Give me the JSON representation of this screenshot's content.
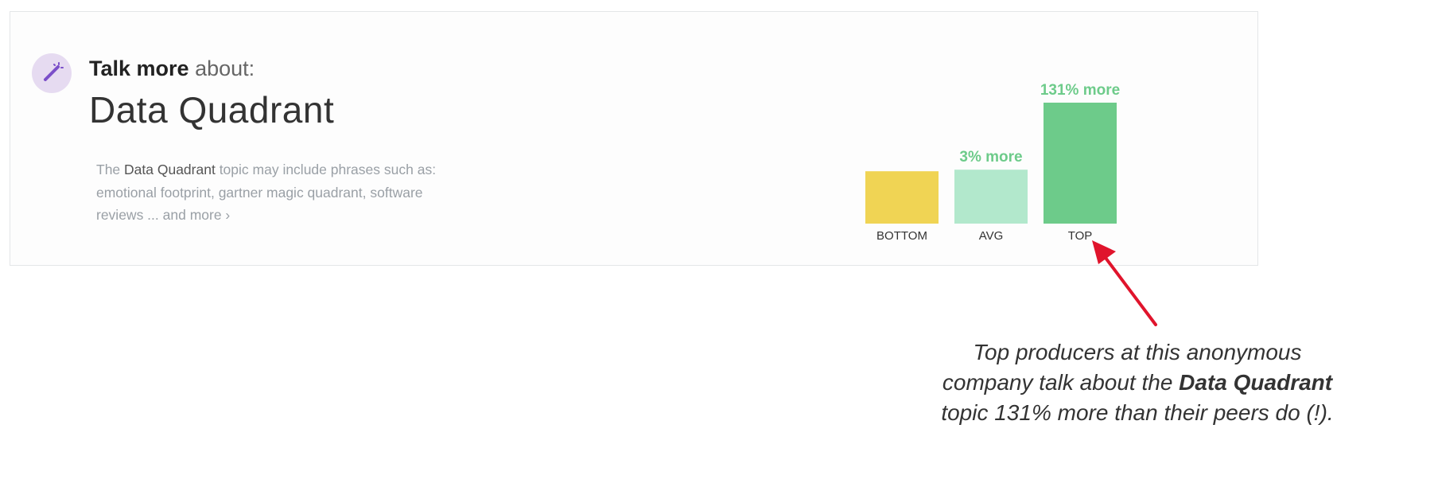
{
  "card": {
    "heading_bold": "Talk more",
    "heading_rest": " about:",
    "topic_title": "Data Quadrant",
    "description": {
      "prefix": "The ",
      "topic": "Data Quadrant",
      "text": " topic may include phrases such as: emotional footprint, gartner magic quadrant, software reviews ... ",
      "more_link": "and more ›"
    },
    "icon": "magic-wand-icon",
    "colors": {
      "badge_bg": "#e6dbf1",
      "badge_icon": "#7b4fc9"
    }
  },
  "chart_data": {
    "type": "bar",
    "categories": [
      "BOTTOM",
      "AVG",
      "TOP"
    ],
    "values": [
      100,
      103,
      231
    ],
    "data_labels": [
      "",
      "3% more",
      "131% more"
    ],
    "colors": [
      "#f0d454",
      "#b2e8cc",
      "#6dcb8a"
    ],
    "label_color": "#6dcb8a"
  },
  "annotation": {
    "line1": "Top producers at this anonymous",
    "line2_pre": "company talk about the ",
    "line2_bold": "Data Quadrant",
    "line3": "topic 131% more than their peers do (!).",
    "arrow_color": "#e0142c"
  }
}
